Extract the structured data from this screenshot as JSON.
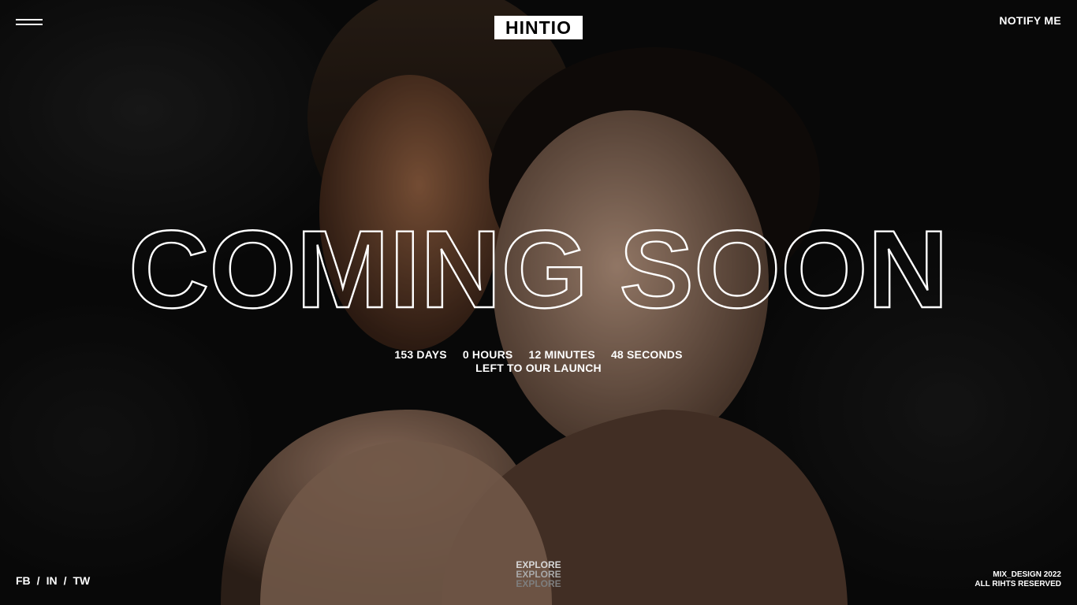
{
  "header": {
    "menu_icon": "hamburger-menu-icon",
    "logo_text": "HINTIO",
    "notify_label": "NOTIFY ME"
  },
  "hero": {
    "headline": "COMING SOON",
    "countdown": {
      "days": "153 DAYS",
      "hours": "0 HOURS",
      "minutes": "12 MINUTES",
      "seconds": "48 SECONDS",
      "subtitle": "LEFT TO OUR LAUNCH"
    }
  },
  "footer": {
    "social": {
      "fb": "FB",
      "sep1": "/",
      "in": "IN",
      "sep2": "/",
      "tw": "TW"
    },
    "explore": [
      "EXPLORE",
      "EXPLORE",
      "EXPLORE"
    ],
    "copyright": {
      "line1": "MIX_DESIGN 2022",
      "line2": "ALL RIHTS RESERVED"
    }
  },
  "colors": {
    "background": "#0c0c0c",
    "text": "#ffffff",
    "logo_bg": "#ffffff",
    "logo_text": "#000000"
  }
}
